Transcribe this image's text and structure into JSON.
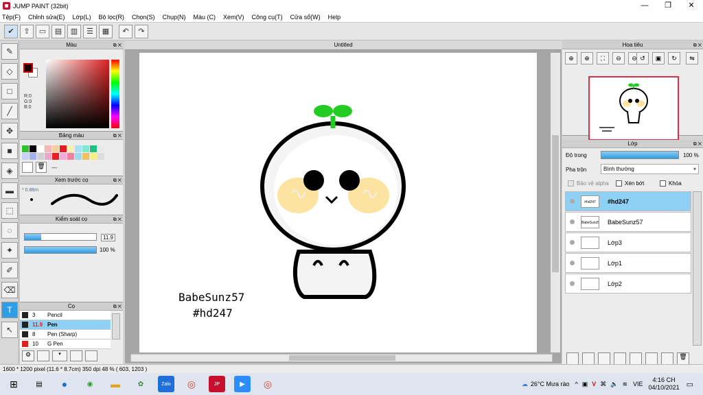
{
  "window": {
    "title": "JUMP PAINT (32bit)",
    "minimize": "—",
    "maximize": "❐",
    "close": "✕"
  },
  "menu": [
    "Tệp(F)",
    "Chỉnh sửa(E)",
    "Lớp(L)",
    "Bộ lọc(R)",
    "Chọn(S)",
    "Chụp(N)",
    "Màu (C)",
    "Xem(V)",
    "Công cụ(T)",
    "Cửa sổ(W)",
    "Help"
  ],
  "panels": {
    "color": {
      "title": "Màu",
      "r": "R:0",
      "g": "G:0",
      "b": "B:0"
    },
    "palette": {
      "title": "Bảng màu",
      "extra": "---"
    },
    "brush_preview": {
      "title": "Xem trước cọ",
      "size": "* 0.86m"
    },
    "brush_control": {
      "title": "Kiểm soát cọ",
      "size_value": "11.9",
      "opacity_value": "100 %",
      "size_fill": 0.23,
      "opacity_fill": 1.0
    },
    "brushes": {
      "title": "Cọ",
      "items": [
        {
          "num": "3",
          "name": "Pencil",
          "color": "#222222"
        },
        {
          "num": "11.9",
          "name": "Pen",
          "color": "#222222"
        },
        {
          "num": "8",
          "name": "Pen (Sharp)",
          "color": "#222222"
        },
        {
          "num": "10",
          "name": "G Pen",
          "color": "#e02020"
        }
      ]
    }
  },
  "document": {
    "tab": "Untitled",
    "signature_line1": "BabeSunz57",
    "signature_line2": "#hd247"
  },
  "navigator": {
    "title": "Hoa tiêu"
  },
  "layers": {
    "title": "Lớp",
    "opacity_label": "Độ trong",
    "opacity_value": "100 %",
    "blend_label": "Pha trộn",
    "blend_value": "Bình thường",
    "protect_alpha": "Bảo vệ alpha",
    "clipping": "Xén bớt",
    "lock": "Khóa",
    "items": [
      {
        "name": "#hd247",
        "thumb": "#hd247"
      },
      {
        "name": "BabeSunz57",
        "thumb": "BabeSunz57"
      },
      {
        "name": "Lớp3",
        "thumb": ""
      },
      {
        "name": "Lớp1",
        "thumb": ""
      },
      {
        "name": "Lớp2",
        "thumb": ""
      }
    ]
  },
  "status": "1600 * 1200 pixel   (11.6 * 8.7cm)   350 dpi   48 %   ( 603, 1203 )",
  "taskbar": {
    "weather": "26°C  Mưa rào",
    "lang": "VIE",
    "time": "4:16 CH",
    "date": "04/10/2021"
  },
  "colors": {
    "accent": "#2e9fe6",
    "selected_row": "#8fd0f5",
    "sprout": "#22cc22",
    "cheek": "#fde3a0"
  }
}
